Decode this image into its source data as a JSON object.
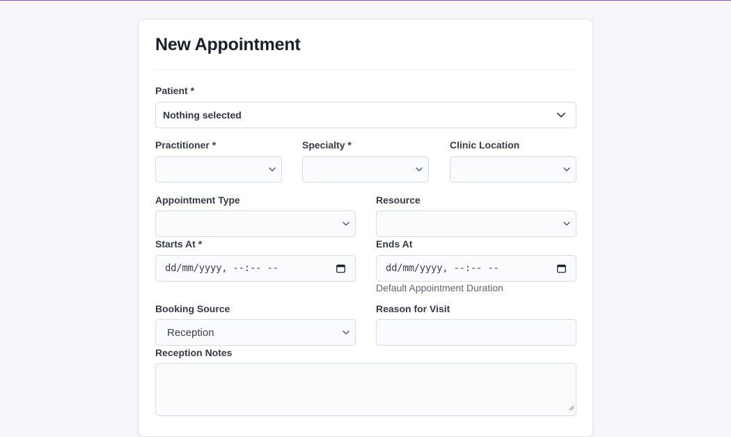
{
  "form": {
    "title": "New Appointment",
    "patient": {
      "label": "Patient *",
      "value": "Nothing selected"
    },
    "practitioner": {
      "label": "Practitioner *",
      "value": ""
    },
    "specialty": {
      "label": "Specialty *",
      "value": ""
    },
    "clinic_location": {
      "label": "Clinic Location",
      "value": ""
    },
    "appointment_type": {
      "label": "Appointment Type",
      "value": ""
    },
    "resource": {
      "label": "Resource",
      "value": ""
    },
    "starts_at": {
      "label": "Starts At *",
      "placeholder": "dd/mm/yyyy, --:-- --"
    },
    "ends_at": {
      "label": "Ends At",
      "placeholder": "dd/mm/yyyy, --:-- --",
      "hint": "Default Appointment Duration"
    },
    "booking_source": {
      "label": "Booking Source",
      "value": "Reception"
    },
    "reason_for_visit": {
      "label": "Reason for Visit",
      "value": ""
    },
    "reception_notes": {
      "label": "Reception Notes",
      "value": ""
    }
  },
  "icons": {
    "select": "chevron-down-icon",
    "date": "calendar-icon",
    "resize": "resize-grip-icon"
  },
  "colors": {
    "accent_border": "#7e57c2",
    "page_background": "#f6f6fa",
    "card_background": "#ffffff",
    "input_background": "#fafbfc",
    "input_border": "#d6d9df",
    "label_text": "#343a46",
    "title_text": "#1b1f2b"
  }
}
